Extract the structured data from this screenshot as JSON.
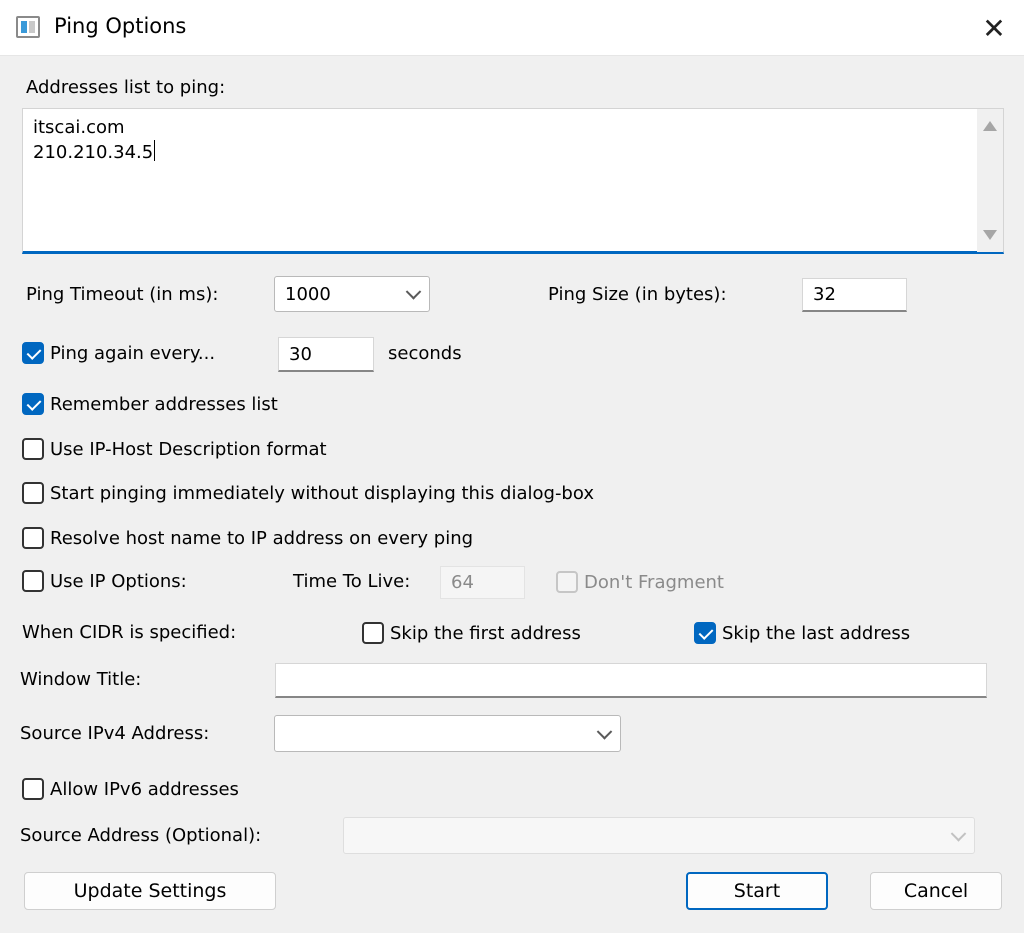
{
  "window": {
    "title": "Ping Options"
  },
  "addresses": {
    "label": "Addresses list to ping:",
    "lines": [
      "itscai.com",
      "210.210.34.5"
    ]
  },
  "ping_timeout": {
    "label": "Ping Timeout (in ms):",
    "value": "1000"
  },
  "ping_size": {
    "label": "Ping Size (in bytes):",
    "value": "32"
  },
  "ping_again": {
    "label": "Ping again every...",
    "checked": true,
    "value": "30",
    "unit": "seconds"
  },
  "options": {
    "remember": {
      "label": "Remember addresses list",
      "checked": true
    },
    "ip_host_format": {
      "label": "Use IP-Host Description format",
      "checked": false
    },
    "start_immediately": {
      "label": "Start pinging immediately without displaying this dialog-box",
      "checked": false
    },
    "resolve_host": {
      "label": "Resolve host name to IP address on every ping",
      "checked": false
    }
  },
  "ip_options": {
    "label": "Use IP Options:",
    "checked": false,
    "ttl_label": "Time To Live:",
    "ttl_value": "64",
    "dont_fragment_label": "Don't Fragment",
    "dont_fragment_checked": false
  },
  "cidr": {
    "label": "When CIDR is specified:",
    "skip_first": {
      "label": "Skip the first address",
      "checked": false
    },
    "skip_last": {
      "label": "Skip the last address",
      "checked": true
    }
  },
  "window_title": {
    "label": "Window Title:",
    "value": ""
  },
  "source_ipv4": {
    "label": "Source IPv4 Address:",
    "value": ""
  },
  "allow_ipv6": {
    "label": "Allow IPv6 addresses",
    "checked": false
  },
  "source_address": {
    "label": "Source Address (Optional):",
    "value": ""
  },
  "buttons": {
    "update": "Update Settings",
    "start": "Start",
    "cancel": "Cancel"
  },
  "colors": {
    "accent": "#0067c0",
    "background": "#f0f0f0"
  }
}
